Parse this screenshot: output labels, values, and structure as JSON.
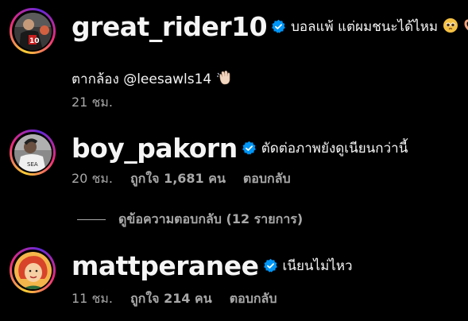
{
  "comments": [
    {
      "username": "great_rider10",
      "text": "บอลแพ้ แต่ผมชนะได้ไหม",
      "second_line": "ตากล้อง @leesawls14",
      "time": "21 ชม."
    },
    {
      "username": "boy_pakorn",
      "text": "ตัดต่อภาพยังดูเนียนกว่านี้",
      "time": "20 ชม.",
      "likes": "ถูกใจ 1,681 คน",
      "reply": "ตอบกลับ"
    },
    {
      "username": "mattperanee",
      "text": "เนียนไม่ไหว",
      "time": "11 ชม.",
      "likes": "ถูกใจ 214 คน",
      "reply": "ตอบกลับ"
    }
  ],
  "view_replies": "ดูข้อความตอบกลับ (12 รายการ)",
  "icons": {
    "verified": "verified-badge-icon",
    "emoji_1": "pleading-face-emoji",
    "emoji_2": "heart-hands-emoji",
    "emoji_3": "waving-hand-emoji"
  },
  "colors": {
    "background": "#000000",
    "text": "#f5f5f5",
    "secondary": "#a8a8a8",
    "verified": "#0095f6"
  }
}
